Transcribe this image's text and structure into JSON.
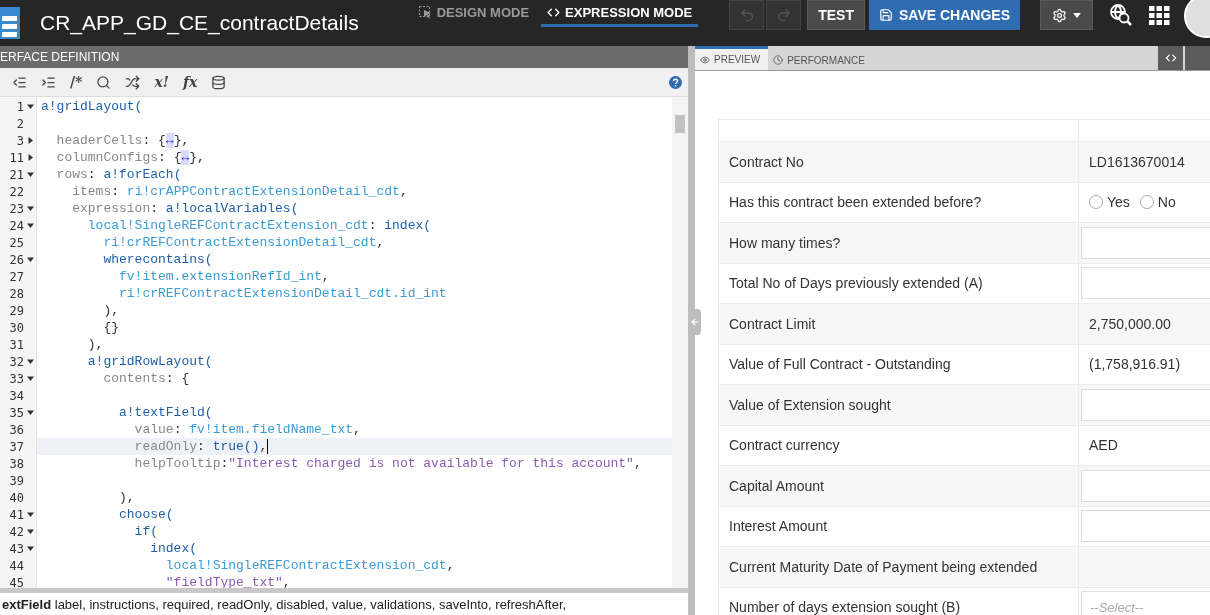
{
  "header": {
    "title": "CR_APP_GD_CE_contractDetails",
    "modes": [
      {
        "label": "DESIGN MODE",
        "kind": "design",
        "selected": false
      },
      {
        "label": "EXPRESSION MODE",
        "kind": "expression",
        "selected": true
      }
    ],
    "history": [
      {
        "kind": "undo",
        "disabled": true
      },
      {
        "kind": "redo",
        "disabled": true
      }
    ],
    "test_button": "TEST",
    "save_button": "SAVE CHANGES"
  },
  "editor": {
    "title": "ERFACE DEFINITION",
    "toolbar": {
      "comment": "/*",
      "variable": "x!",
      "function": "fx"
    },
    "lines": [
      {
        "n": "1",
        "expanded": true,
        "current": false,
        "tokens": [
          {
            "kind": "fn",
            "text": "a!gridLayout("
          }
        ]
      },
      {
        "n": "2",
        "current": false
      },
      {
        "n": "3",
        "expanded": false,
        "current": false,
        "tokens": [
          {
            "kind": "key",
            "text": "  headerCells"
          },
          {
            "kind": "plain",
            "text": ": {"
          },
          {
            "kind": "marker",
            "text": "↔"
          },
          {
            "kind": "plain",
            "text": "},"
          }
        ]
      },
      {
        "n": "11",
        "expanded": false,
        "current": false,
        "tokens": [
          {
            "kind": "key",
            "text": "  columnConfigs"
          },
          {
            "kind": "plain",
            "text": ": {"
          },
          {
            "kind": "marker",
            "text": "↔"
          },
          {
            "kind": "plain",
            "text": "},"
          }
        ]
      },
      {
        "n": "21",
        "expanded": true,
        "current": false,
        "tokens": [
          {
            "kind": "key",
            "text": "  rows"
          },
          {
            "kind": "plain",
            "text": ": "
          },
          {
            "kind": "fn",
            "text": "a!forEach("
          }
        ]
      },
      {
        "n": "22",
        "current": false,
        "tokens": [
          {
            "kind": "key",
            "text": "    items"
          },
          {
            "kind": "plain",
            "text": ": "
          },
          {
            "kind": "var",
            "text": "ri!crAPPContractExtensionDetail_cdt"
          },
          {
            "kind": "plain",
            "text": ","
          }
        ]
      },
      {
        "n": "23",
        "expanded": true,
        "current": false,
        "tokens": [
          {
            "kind": "key",
            "text": "    expression"
          },
          {
            "kind": "plain",
            "text": ": "
          },
          {
            "kind": "fn",
            "text": "a!localVariables("
          }
        ]
      },
      {
        "n": "24",
        "expanded": true,
        "current": false,
        "tokens": [
          {
            "kind": "var",
            "text": "      local!SingleREFContractExtension_cdt"
          },
          {
            "kind": "plain",
            "text": ": "
          },
          {
            "kind": "fn",
            "text": "index("
          }
        ]
      },
      {
        "n": "25",
        "current": false,
        "tokens": [
          {
            "kind": "var",
            "text": "        ri!crREFContractExtensionDetail_cdt"
          },
          {
            "kind": "plain",
            "text": ","
          }
        ]
      },
      {
        "n": "26",
        "expanded": true,
        "current": false,
        "tokens": [
          {
            "kind": "fn",
            "text": "        wherecontains("
          }
        ]
      },
      {
        "n": "27",
        "current": false,
        "tokens": [
          {
            "kind": "var",
            "text": "          fv!item.extensionRefId_int"
          },
          {
            "kind": "plain",
            "text": ","
          }
        ]
      },
      {
        "n": "28",
        "current": false,
        "tokens": [
          {
            "kind": "var",
            "text": "          ri!crREFContractExtensionDetail_cdt.id_int"
          }
        ]
      },
      {
        "n": "29",
        "current": false,
        "tokens": [
          {
            "kind": "plain",
            "text": "        ),"
          }
        ]
      },
      {
        "n": "30",
        "current": false,
        "tokens": [
          {
            "kind": "plain",
            "text": "        {}"
          }
        ]
      },
      {
        "n": "31",
        "current": false,
        "tokens": [
          {
            "kind": "plain",
            "text": "      ),"
          }
        ]
      },
      {
        "n": "32",
        "expanded": true,
        "current": false,
        "tokens": [
          {
            "kind": "fn",
            "text": "      a!gridRowLayout("
          }
        ]
      },
      {
        "n": "33",
        "expanded": true,
        "current": false,
        "tokens": [
          {
            "kind": "key",
            "text": "        contents"
          },
          {
            "kind": "plain",
            "text": ": {"
          }
        ]
      },
      {
        "n": "34",
        "current": false
      },
      {
        "n": "35",
        "expanded": true,
        "current": false,
        "tokens": [
          {
            "kind": "fn",
            "text": "          a!textField("
          }
        ]
      },
      {
        "n": "36",
        "current": false,
        "tokens": [
          {
            "kind": "key",
            "text": "            value"
          },
          {
            "kind": "plain",
            "text": ": "
          },
          {
            "kind": "var",
            "text": "fv!item.fieldName_txt"
          },
          {
            "kind": "plain",
            "text": ","
          }
        ]
      },
      {
        "n": "37",
        "current": true,
        "tokens": [
          {
            "kind": "key",
            "text": "            readOnly"
          },
          {
            "kind": "plain",
            "text": ": "
          },
          {
            "kind": "fn",
            "text": "true()"
          },
          {
            "kind": "plain",
            "text": ","
          }
        ]
      },
      {
        "n": "38",
        "current": false,
        "tokens": [
          {
            "kind": "key",
            "text": "            helpTooltip"
          },
          {
            "kind": "plain",
            "text": ":"
          },
          {
            "kind": "str",
            "text": "\"Interest charged is not available for this account\""
          },
          {
            "kind": "plain",
            "text": ","
          }
        ]
      },
      {
        "n": "39",
        "current": false
      },
      {
        "n": "40",
        "current": false,
        "tokens": [
          {
            "kind": "plain",
            "text": "          ),"
          }
        ]
      },
      {
        "n": "41",
        "expanded": true,
        "current": false,
        "tokens": [
          {
            "kind": "fn",
            "text": "          choose("
          }
        ]
      },
      {
        "n": "42",
        "expanded": true,
        "current": false,
        "tokens": [
          {
            "kind": "fn",
            "text": "            if("
          }
        ]
      },
      {
        "n": "43",
        "expanded": true,
        "current": false,
        "tokens": [
          {
            "kind": "fn",
            "text": "              index("
          }
        ]
      },
      {
        "n": "44",
        "current": false,
        "tokens": [
          {
            "kind": "var",
            "text": "                local!SingleREFContractExtension_cdt"
          },
          {
            "kind": "plain",
            "text": ","
          }
        ]
      },
      {
        "n": "45",
        "current": false,
        "tokens": [
          {
            "kind": "str",
            "text": "                \"fieldType_txt\""
          },
          {
            "kind": "plain",
            "text": ","
          }
        ]
      }
    ],
    "help_text": "**extField** label, instructions, required, readOnly, disabled, value, validations, saveInto, refreshAfter,"
  },
  "preview": {
    "tabs": [
      {
        "label": "PREVIEW",
        "kind": "preview",
        "selected": true
      },
      {
        "label": "PERFORMANCE",
        "kind": "performance",
        "selected": false
      }
    ],
    "rows": [
      {
        "label": "Contract No",
        "kind": "text",
        "value": "LD1613670014"
      },
      {
        "label": "Has this contract been extended before?",
        "kind": "radio",
        "options": [
          {
            "label": "Yes",
            "selected": false
          },
          {
            "label": "No",
            "selected": false
          }
        ]
      },
      {
        "label": "How many times?",
        "kind": "input"
      },
      {
        "label": "Total No of Days previously extended (A)",
        "kind": "input"
      },
      {
        "label": "Contract Limit",
        "kind": "text",
        "value": "2,750,000.00"
      },
      {
        "label": "Value of Full Contract - Outstanding",
        "kind": "text",
        "value": "(1,758,916.91)"
      },
      {
        "label": "Value of Extension sought",
        "kind": "input"
      },
      {
        "label": "Contract currency",
        "kind": "text",
        "value": "AED"
      },
      {
        "label": "Capital Amount",
        "kind": "input"
      },
      {
        "label": "Interest Amount",
        "kind": "input"
      },
      {
        "label": "Current Maturity Date of Payment being extended",
        "kind": "empty"
      },
      {
        "label": "Number of days extension sought (B)",
        "kind": "select",
        "placeholder": "--Select--"
      }
    ]
  }
}
